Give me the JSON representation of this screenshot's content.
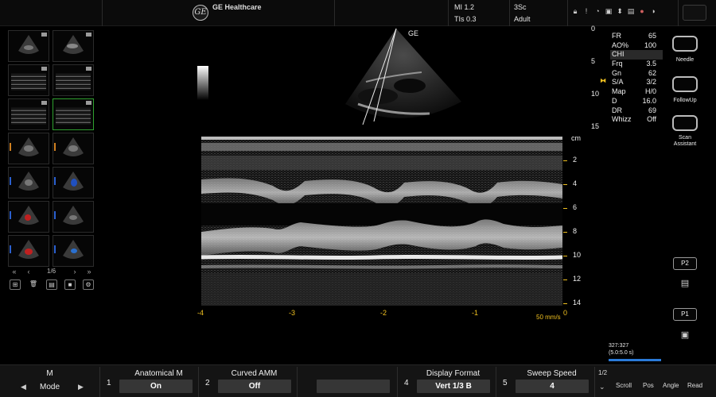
{
  "header": {
    "brand": "GE Healthcare",
    "logo_text": "GE",
    "mi": "MI 1.2",
    "tis": "TIs 0.3",
    "probe": "3Sc",
    "preset": "Adult"
  },
  "image": {
    "probe_label": "GE",
    "depth_ticks_b": [
      "0",
      "5",
      "10",
      "15"
    ],
    "depth_ticks_m": [
      "2",
      "4",
      "6",
      "8",
      "10",
      "12",
      "14"
    ],
    "depth_unit": "cm",
    "time_ticks": [
      "-4",
      "-3",
      "-2",
      "-1",
      "0"
    ],
    "sweep_label": "50 mm/s"
  },
  "params": [
    {
      "label": "FR",
      "value": "65"
    },
    {
      "label": "AO%",
      "value": "100"
    },
    {
      "label": "CHI",
      "value": ""
    },
    {
      "label": "Frq",
      "value": "3.5"
    },
    {
      "label": "Gn",
      "value": "62"
    },
    {
      "label": "S/A",
      "value": "3/2"
    },
    {
      "label": "Map",
      "value": "H/0"
    },
    {
      "label": "D",
      "value": "16.0"
    },
    {
      "label": "DR",
      "value": "69"
    },
    {
      "label": "Whizz",
      "value": "Off"
    }
  ],
  "right_buttons": {
    "needle": "Needle",
    "followup": "FollowUp",
    "scan_assistant_1": "Scan",
    "scan_assistant_2": "Assistant",
    "p2": "P2",
    "p1": "P1"
  },
  "thumbnails": {
    "page_indicator": "1/6"
  },
  "cine": {
    "frames": "327:327",
    "time": "(5.0:5.0 s)"
  },
  "bottom": {
    "mode_title": "M",
    "mode_value": "Mode",
    "anatomical_num": "1",
    "anatomical_title": "Anatomical M",
    "anatomical_value": "On",
    "curved_num": "2",
    "curved_title": "Curved AMM",
    "curved_value": "Off",
    "display_num": "4",
    "display_title": "Display Format",
    "display_value": "Vert 1/3 B",
    "sweep_num": "5",
    "sweep_title": "Sweep Speed",
    "sweep_value": "4",
    "page": "1/2",
    "soft_buttons": [
      "Scroll",
      "Pos",
      "Angle",
      "Read"
    ]
  },
  "colors": {
    "accent_yellow": "#f0c020",
    "cine_blue": "#2a7ad8",
    "selected_green": "#2fa02f"
  }
}
